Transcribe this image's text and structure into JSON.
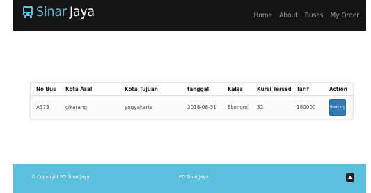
{
  "navbar": {
    "brand_part1": "Sinar",
    "brand_part2": "Jaya",
    "brand_icon": "bus-icon",
    "links": [
      "Home",
      "About",
      "Buses",
      "My Order"
    ]
  },
  "table": {
    "headers": [
      "No Bus",
      "Kota Asal",
      "Kota Tujuan",
      "tanggal",
      "Kelas",
      "Kursi Tersedia",
      "Tarif",
      "Action"
    ],
    "rows": [
      {
        "no_bus": "A373",
        "kota_asal": "cikarang",
        "kota_tujuan": "yogyakarta",
        "tanggal": "2018-08-31",
        "kelas": "Ekonomi",
        "kursi_tersedia": "32",
        "tarif": "180000",
        "action_label": "Booking"
      }
    ]
  },
  "footer": {
    "copyright": "© Copyright PO Sinar Jaya",
    "center": "PO Sinar Jaya",
    "back_to_top_icon": "chevron-up-icon"
  },
  "colors": {
    "navbar_bg": "#151515",
    "brand_accent": "#5bc0de",
    "footer_bg": "#5bc0de",
    "button_primary": "#337ab7"
  }
}
